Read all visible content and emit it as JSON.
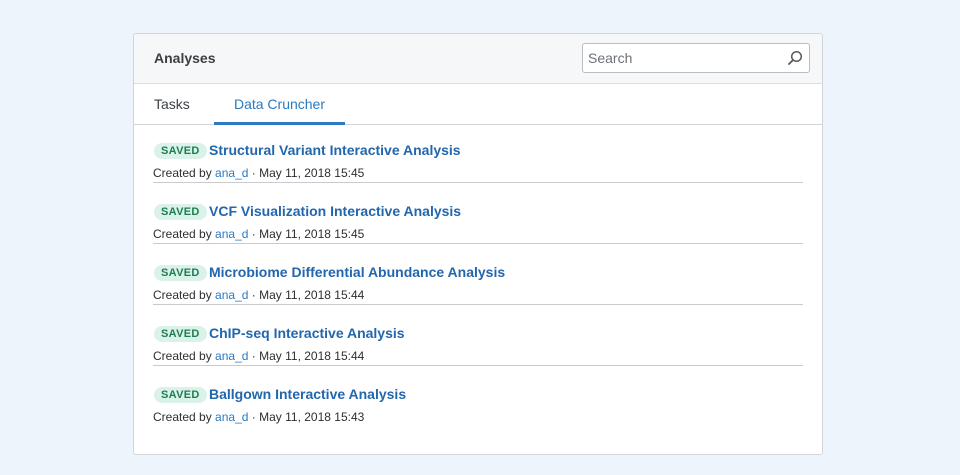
{
  "panel": {
    "title": "Analyses"
  },
  "search": {
    "placeholder": "Search",
    "value": ""
  },
  "tabs": [
    {
      "label": "Tasks",
      "active": false
    },
    {
      "label": "Data Cruncher",
      "active": true
    }
  ],
  "created_prefix": "Created by",
  "separator": "·",
  "analyses": [
    {
      "status": "SAVED",
      "title": "Structural Variant Interactive Analysis",
      "author": "ana_d",
      "date": "May 11, 2018 15:45"
    },
    {
      "status": "SAVED",
      "title": "VCF Visualization Interactive Analysis",
      "author": "ana_d",
      "date": "May 11, 2018 15:45"
    },
    {
      "status": "SAVED",
      "title": "Microbiome Differential Abundance Analysis",
      "author": "ana_d",
      "date": "May 11, 2018 15:44"
    },
    {
      "status": "SAVED",
      "title": "ChIP-seq Interactive Analysis",
      "author": "ana_d",
      "date": "May 11, 2018 15:44"
    },
    {
      "status": "SAVED",
      "title": "Ballgown Interactive Analysis",
      "author": "ana_d",
      "date": "May 11, 2018 15:43"
    }
  ],
  "colors": {
    "accent": "#2a7bc1",
    "title_link": "#2266ae",
    "badge_bg": "#dbf2ea",
    "badge_text": "#1d7d4f",
    "page_bg": "#eef4fb"
  },
  "icons": {
    "search": "search-icon"
  }
}
